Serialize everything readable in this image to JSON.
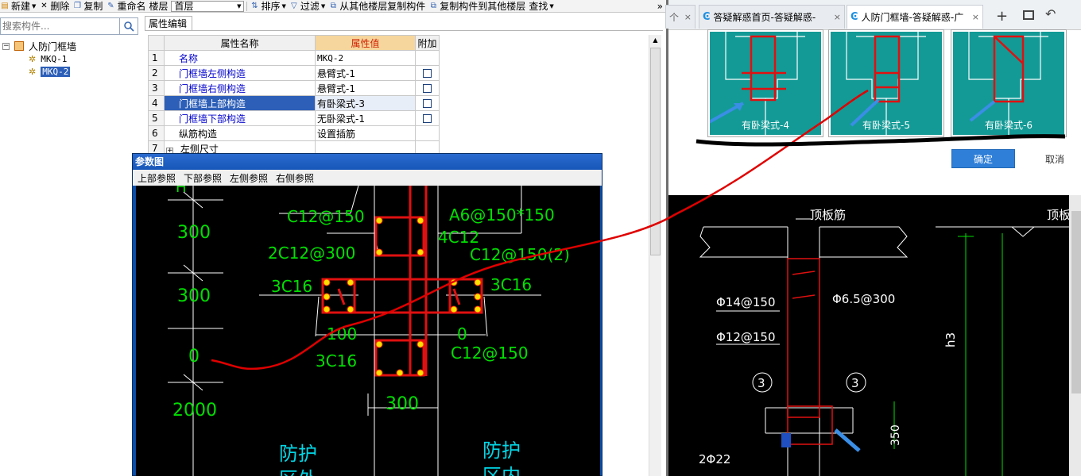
{
  "toolbar": {
    "new_label": "新建",
    "delete_label": "删除",
    "copy_label": "复制",
    "rename_label": "重命名",
    "floor_label": "楼层",
    "floor_value": "首层",
    "sort_label": "排序",
    "filter_label": "过滤",
    "copy_from_label": "从其他楼层复制构件",
    "copy_to_label": "复制构件到其他楼层",
    "find_label": "查找",
    "more_label": "»"
  },
  "search": {
    "placeholder": "搜索构件..."
  },
  "tree": {
    "root": "人防门框墙",
    "items": [
      "MKQ-1",
      "MKQ-2"
    ],
    "selected": "MKQ-2"
  },
  "property_tab": "属性编辑",
  "property_table": {
    "headers": [
      "属性名称",
      "属性值",
      "附加"
    ],
    "rows": [
      {
        "num": "1",
        "name": "名称",
        "value": "MKQ-2",
        "has_check": false
      },
      {
        "num": "2",
        "name": "门框墙左侧构造",
        "value": "悬臂式-1",
        "has_check": true
      },
      {
        "num": "3",
        "name": "门框墙右侧构造",
        "value": "悬臂式-1",
        "has_check": true
      },
      {
        "num": "4",
        "name": "门框墙上部构造",
        "value": "有卧梁式-3",
        "has_check": true
      },
      {
        "num": "5",
        "name": "门框墙下部构造",
        "value": "无卧梁式-1",
        "has_check": true
      },
      {
        "num": "6",
        "name": "纵筋构造",
        "value": "设置插筋",
        "has_check": false
      },
      {
        "num": "7",
        "name": "左侧尺寸",
        "value": "",
        "has_check": false
      }
    ],
    "selected_row": 4
  },
  "param_dialog": {
    "title": "参数图",
    "menu": [
      "上部参照",
      "下部参照",
      "左侧参照",
      "右侧参照"
    ],
    "left_dims": [
      "300",
      "300",
      "0",
      "2000"
    ],
    "top_partial": "H",
    "labels": {
      "c12_150_top": "C12@150",
      "a6": "A6@150*150",
      "c4c12": "4C12",
      "c2c12": "2C12@300",
      "c12_150_2": "C12@150(2)",
      "c3c16_left": "3C16",
      "c3c16_right": "3C16",
      "d100": "100",
      "d0": "0",
      "c3c16_bottom": "3C16",
      "c12_150_bottom": "C12@150",
      "d300": "300",
      "protect_left_1": "防护",
      "protect_left_2": "区外",
      "protect_right_1": "防护",
      "protect_right_2": "区内"
    }
  },
  "browser": {
    "tabs": [
      {
        "label": "个",
        "close": "×"
      },
      {
        "label": "答疑解惑首页-答疑解惑-",
        "close": "×"
      },
      {
        "label": "人防门框墙-答疑解惑-广",
        "close": "×"
      }
    ],
    "new_tab": "+",
    "thumbnails": [
      "有卧梁式-4",
      "有卧梁式-5",
      "有卧梁式-6"
    ],
    "ok_label": "确定",
    "cancel_label": "取消",
    "drawing": {
      "top_label": "顶板筋",
      "top_label_right": "顶板",
      "phi14": "Φ14@150",
      "phi65": "Φ6.5@300",
      "phi12": "Φ12@150",
      "mark_left": "3",
      "mark_right": "3",
      "h3": "h3",
      "d350": "350",
      "phi22": "2Φ22"
    }
  },
  "colors": {
    "accent_blue": "#2d5fb8",
    "header_value_bg": "#f6d69c",
    "teal_thumb": "#139a96",
    "cad_green": "#00e000",
    "cad_red": "#e01010",
    "cad_cyan": "#00d8e8",
    "annotation_red": "#e00000"
  }
}
